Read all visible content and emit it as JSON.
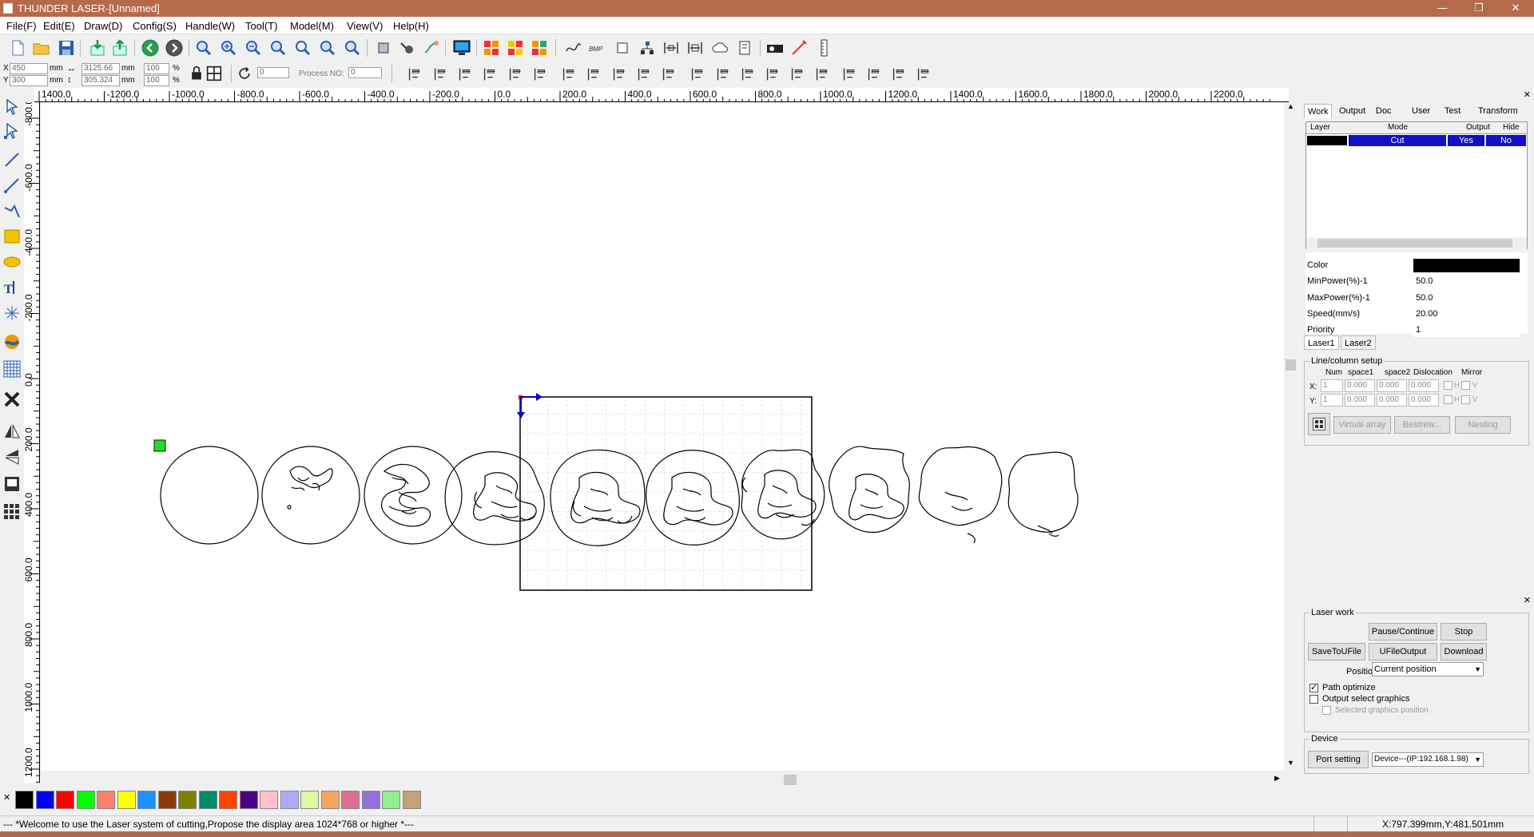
{
  "window": {
    "title": "THUNDER LASER-[Unnamed]",
    "minimize_glyph": "—",
    "restore_glyph": "❐",
    "close_glyph": "✕"
  },
  "menu": [
    "File(F)",
    "Edit(E)",
    "Draw(D)",
    "Config(S)",
    "Handle(W)",
    "Tool(T)",
    "Model(M)",
    "View(V)",
    "Help(H)"
  ],
  "coords": {
    "x_label": "X",
    "x_value": "450",
    "y_label": "Y",
    "y_value": "300",
    "unit": "mm",
    "width": "3125.66",
    "height": "305.324",
    "scale_x": "100",
    "scale_y": "100",
    "percent": "%",
    "rotate": "0",
    "process_label": "Process NO:",
    "process_value": "0"
  },
  "toolbar_icons": [
    "new-file",
    "open-folder",
    "save",
    "import",
    "export",
    "back",
    "forward",
    "zoom-tool",
    "zoom-in",
    "zoom-out",
    "zoom-page",
    "zoom-select",
    "zoom-fit",
    "zoom-window",
    "rectangle-select",
    "node-edit",
    "lasso",
    "monitor",
    "array-red",
    "array-yellow",
    "array-orange",
    "curve-smooth",
    "bmp",
    "square",
    "tree",
    "align-center",
    "align-space",
    "cloud",
    "book",
    "camera",
    "laser-pointer",
    "ruler"
  ],
  "ruler_top": [
    "1400.0",
    "-1200.0",
    "-1000.0",
    "-800.0",
    "-600.0",
    "-400.0",
    "-200.0",
    "0.0",
    "200.0",
    "400.0",
    "600.0",
    "800.0",
    "1000.0",
    "1200.0",
    "1400.0",
    "1600.0",
    "1800.0",
    "2000.0",
    "2200.0"
  ],
  "ruler_left": [
    "-800.0",
    "-600.0",
    "-400.0",
    "-200.0",
    "0.0",
    "200.0",
    "400.0",
    "600.0",
    "800.0",
    "1000.0",
    "1200.0"
  ],
  "right_panel": {
    "tabs": [
      "Work",
      "Output",
      "Doc",
      "User",
      "Test",
      "Transform"
    ],
    "layer_headers": [
      "Layer",
      "Mode",
      "Output",
      "Hide"
    ],
    "layer_row": {
      "mode": "Cut",
      "output": "Yes",
      "hide": "No",
      "color": "#000000"
    },
    "props": [
      {
        "name": "Color",
        "value": ""
      },
      {
        "name": "MinPower(%)-1",
        "value": "50.0"
      },
      {
        "name": "MaxPower(%)-1",
        "value": "50.0"
      },
      {
        "name": "Speed(mm/s)",
        "value": "20.00"
      },
      {
        "name": "Priority",
        "value": "1"
      }
    ],
    "laser_tabs": [
      "Laser1",
      "Laser2"
    ],
    "array": {
      "title": "Line/column setup",
      "headers": [
        "Num",
        "space1",
        "space2",
        "Dislocation",
        "Mirror"
      ],
      "x_label": "X:",
      "y_label": "Y:",
      "num": "1",
      "space": "0.000",
      "h": "H",
      "v": "V",
      "buttons": [
        "Virtual array",
        "Bestrew...",
        "Nesting"
      ]
    }
  },
  "laser_work": {
    "title": "Laser work",
    "pause": "Pause/Continue",
    "stop": "Stop",
    "save_ufile": "SaveToUFile",
    "ufile_output": "UFileOutput",
    "download": "Download",
    "position_label": "Position:",
    "position_value": "Current position",
    "path_optimize": "Path optimize",
    "output_select": "Output select graphics",
    "selected_pos": "Selected graphics position",
    "device_title": "Device",
    "port_setting": "Port setting",
    "device_value": "Device---(IP:192.168.1.98)"
  },
  "palette": [
    "#000000",
    "#0000ff",
    "#ff0000",
    "#00ff00",
    "#fa8072",
    "#ffff00",
    "#1e90ff",
    "#8b3a0e",
    "#808000",
    "#008b6b",
    "#ff4500",
    "#4b0082",
    "#ffc0cb",
    "#b0a8f8",
    "#dcf8a0",
    "#f4a460",
    "#db7093",
    "#9370db",
    "#90ee90",
    "#c2a27a"
  ],
  "status": {
    "message": "--- *Welcome to use the Laser system of cutting,Propose the display area 1024*768 or higher *---",
    "position": "X:797.399mm,Y:481.501mm"
  }
}
